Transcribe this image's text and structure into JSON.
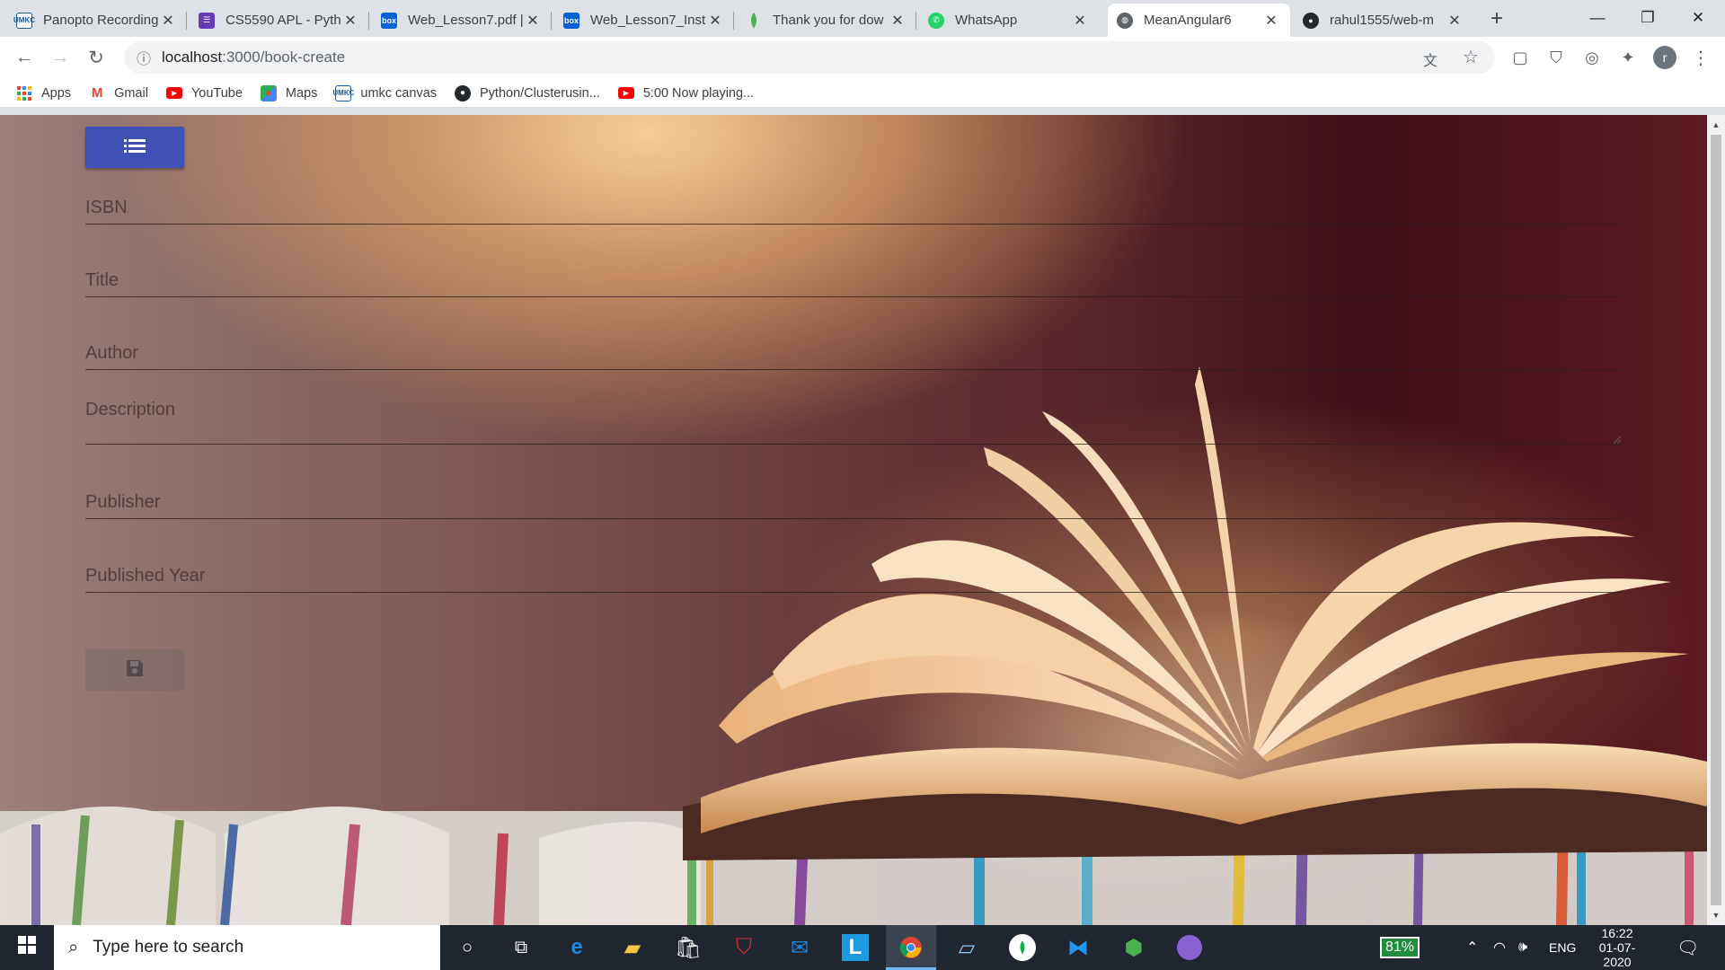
{
  "browser": {
    "tabs": [
      {
        "title": "Panopto Recording",
        "favicon": "umkc-icon",
        "color": "#1a5aa0"
      },
      {
        "title": "CS5590 APL - Pyth",
        "favicon": "form-icon",
        "color": "#673ab7"
      },
      {
        "title": "Web_Lesson7.pdf |",
        "favicon": "box-icon",
        "color": "#0061d5"
      },
      {
        "title": "Web_Lesson7_Inst",
        "favicon": "box-icon",
        "color": "#0061d5"
      },
      {
        "title": "Thank you for dow",
        "favicon": "mongodb-leaf-icon",
        "color": "#4caf50"
      },
      {
        "title": "WhatsApp",
        "favicon": "whatsapp-icon",
        "color": "#25d366"
      },
      {
        "title": "MeanAngular6",
        "favicon": "globe-icon",
        "color": "#5f6368",
        "active": true
      },
      {
        "title": "rahul1555/web-m",
        "favicon": "github-icon",
        "color": "#24292e"
      }
    ],
    "new_tab": "+",
    "address": {
      "host": "localhost",
      "path": ":3000/book-create"
    },
    "bookmarks": [
      {
        "label": "Apps",
        "icon": "apps-grid-icon"
      },
      {
        "label": "Gmail",
        "icon": "gmail-icon"
      },
      {
        "label": "YouTube",
        "icon": "youtube-icon"
      },
      {
        "label": "Maps",
        "icon": "maps-icon"
      },
      {
        "label": "umkc canvas",
        "icon": "umkc-icon"
      },
      {
        "label": "Python/Clusterusin...",
        "icon": "github-icon"
      },
      {
        "label": "5:00 Now playing...",
        "icon": "youtube-icon"
      }
    ],
    "profile_initial": "r"
  },
  "form": {
    "fields": [
      {
        "label": "ISBN"
      },
      {
        "label": "Title"
      },
      {
        "label": "Author"
      },
      {
        "label": "Description"
      },
      {
        "label": "Publisher"
      },
      {
        "label": "Published Year"
      }
    ],
    "accent_color": "#3f51b5"
  },
  "taskbar": {
    "search_placeholder": "Type here to search",
    "battery": "81%",
    "language": "ENG",
    "time": "16:22",
    "date": "01-07-2020"
  }
}
